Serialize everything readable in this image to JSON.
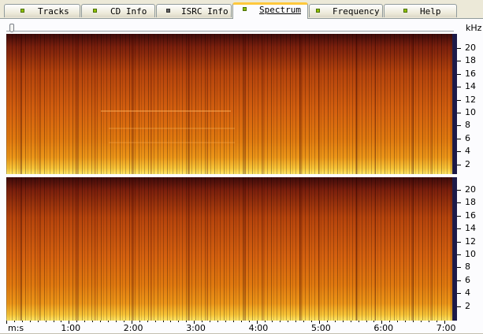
{
  "tabs": [
    {
      "label": "Tracks",
      "led": "#90c000",
      "active": false
    },
    {
      "label": "CD Info",
      "led": "#90c000",
      "active": false
    },
    {
      "label": "ISRC Info",
      "led": "#606060",
      "active": false
    },
    {
      "label": "Spectrum",
      "led": "#90c000",
      "active": true
    },
    {
      "label": "Frequency",
      "led": "#90c000",
      "active": false
    },
    {
      "label": "Help",
      "led": "#90c000",
      "active": false
    }
  ],
  "spectrum": {
    "unit": "kHz",
    "freq_ticks": [
      "20",
      "18",
      "16",
      "14",
      "12",
      "10",
      "8",
      "6",
      "4",
      "2"
    ],
    "time_ticks": [
      "m:s",
      "1:00",
      "2:00",
      "3:00",
      "4:00",
      "5:00",
      "6:00",
      "7:00"
    ],
    "channels": [
      "top",
      "bottom"
    ]
  },
  "colors": {
    "spectrogram_low": "#3d0a0a",
    "spectrogram_mid": "#d4600f",
    "spectrogram_high": "#fde568",
    "scale_bar": "#1c1a48",
    "active_tab_accent": "#ffc83c"
  }
}
